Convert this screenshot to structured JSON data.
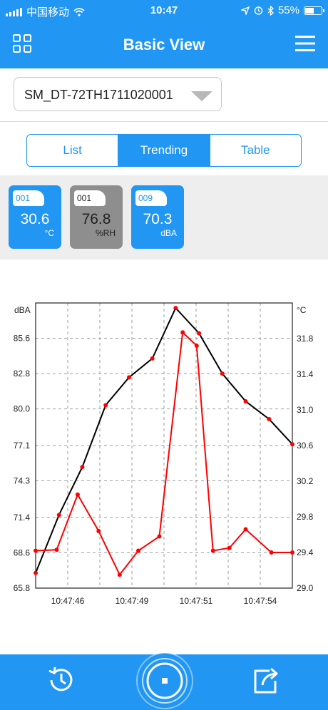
{
  "status_bar": {
    "carrier": "中国移动",
    "time": "10:47",
    "battery": "55%",
    "battery_level": 0.55
  },
  "header": {
    "title": "Basic View",
    "grid_icon": "grid-icon",
    "menu_icon": "hamburger-menu-icon"
  },
  "device_selector": {
    "value": "SM_DT-72TH1711020001"
  },
  "view_tabs": [
    {
      "label": "List",
      "active": false
    },
    {
      "label": "Trending",
      "active": true
    },
    {
      "label": "Table",
      "active": false
    }
  ],
  "sensor_cards": [
    {
      "tag": "001",
      "value": "30.6",
      "unit": "°C",
      "color": "#2196f3"
    },
    {
      "tag": "001",
      "value": "76.8",
      "unit": "%RH",
      "color": "#8e8e8e"
    },
    {
      "tag": "009",
      "value": "70.3",
      "unit": "dBA",
      "color": "#2196f3"
    }
  ],
  "chart_data": {
    "type": "line",
    "left_axis_label": "dBA",
    "right_axis_label": "°C",
    "y_left": {
      "min": 65.8,
      "max": 88.4,
      "ticks": [
        "85.6",
        "82.8",
        "80.0",
        "77.1",
        "74.3",
        "71.4",
        "68.6",
        "65.8"
      ]
    },
    "y_right": {
      "min": 29.0,
      "max": 32.2,
      "ticks": [
        "31.8",
        "31.4",
        "31.0",
        "30.6",
        "30.2",
        "29.8",
        "29.4",
        "29.0"
      ]
    },
    "x_labels": [
      "10:47:46",
      "10:47:49",
      "10:47:51",
      "10:47:54"
    ],
    "grid": true,
    "series": [
      {
        "axis": "left",
        "color": "#000000",
        "x": [
          0,
          1,
          2,
          3,
          4,
          5,
          6,
          7,
          8,
          9,
          10,
          11
        ],
        "values": [
          67.0,
          71.6,
          75.4,
          80.3,
          82.5,
          84.0,
          88.0,
          86.0,
          82.8,
          80.6,
          79.2,
          77.2
        ]
      },
      {
        "axis": "right",
        "color": "#ff0000",
        "x": [
          0,
          0.9,
          1.8,
          2.7,
          3.6,
          4.4,
          5.3,
          6.3,
          6.9,
          7.6,
          8.3,
          9.0,
          10.1,
          11.0
        ],
        "values": [
          29.42,
          29.43,
          30.05,
          29.64,
          29.15,
          29.42,
          29.58,
          31.87,
          31.72,
          29.42,
          29.45,
          29.66,
          29.4,
          29.4
        ]
      }
    ]
  },
  "bottom_bar": {
    "history_icon": "history-icon",
    "record_icon": "stop-record-icon",
    "share_icon": "share-icon"
  },
  "colors": {
    "primary": "#2196f3",
    "card_gray": "#8e8e8e",
    "line_dba": "#000000",
    "line_temp": "#ff0000"
  }
}
